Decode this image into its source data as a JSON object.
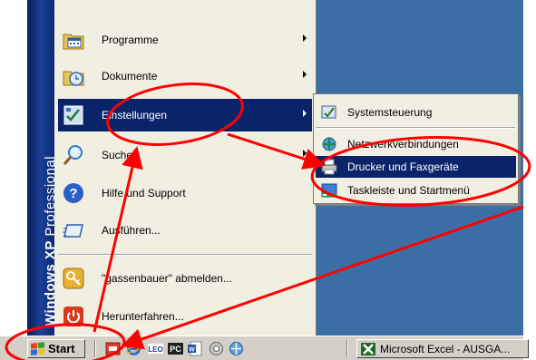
{
  "brand": {
    "prefix": "Windows XP",
    "suffix": "Professional"
  },
  "start_menu": {
    "items": [
      {
        "label": "Programme",
        "icon": "programs-folder-icon",
        "has_submenu": true
      },
      {
        "label": "Dokumente",
        "icon": "documents-icon",
        "has_submenu": true
      },
      {
        "label": "Einstellungen",
        "icon": "settings-icon",
        "has_submenu": true,
        "selected": true
      },
      {
        "label": "Suchen",
        "icon": "search-icon",
        "has_submenu": true
      },
      {
        "label": "Hilfe und Support",
        "icon": "help-icon",
        "has_submenu": false
      },
      {
        "label": "Ausführen...",
        "icon": "run-icon",
        "has_submenu": false
      },
      {
        "label": "\"gassenbauer\" abmelden...",
        "icon": "logoff-icon",
        "has_submenu": false
      },
      {
        "label": "Herunterfahren...",
        "icon": "shutdown-icon",
        "has_submenu": false
      }
    ]
  },
  "settings_submenu": {
    "items": [
      {
        "label": "Systemsteuerung",
        "icon": "control-panel-icon"
      },
      {
        "label": "Netzwerkverbindungen",
        "icon": "network-icon"
      },
      {
        "label": "Drucker und Faxgeräte",
        "icon": "printer-icon",
        "selected": true
      },
      {
        "label": "Taskleiste und Startmenü",
        "icon": "taskbar-icon"
      }
    ]
  },
  "taskbar": {
    "start_label": "Start",
    "quick_launch": [
      "quick-launch-app-icon",
      "internet-explorer-icon",
      "leo-icon",
      "pc-icon",
      "word-icon",
      "media-icon",
      "network-share-icon"
    ],
    "task": {
      "label": "Microsoft Excel - AUSGA...",
      "icon": "excel-icon"
    }
  },
  "colors": {
    "desktop": "#3a6ea5",
    "menu_bg": "#f1efe2",
    "selection": "#0a246a",
    "brand_band": "#1b3f95",
    "taskbar": "#d4d0c8",
    "annotation": "#ff0000"
  }
}
